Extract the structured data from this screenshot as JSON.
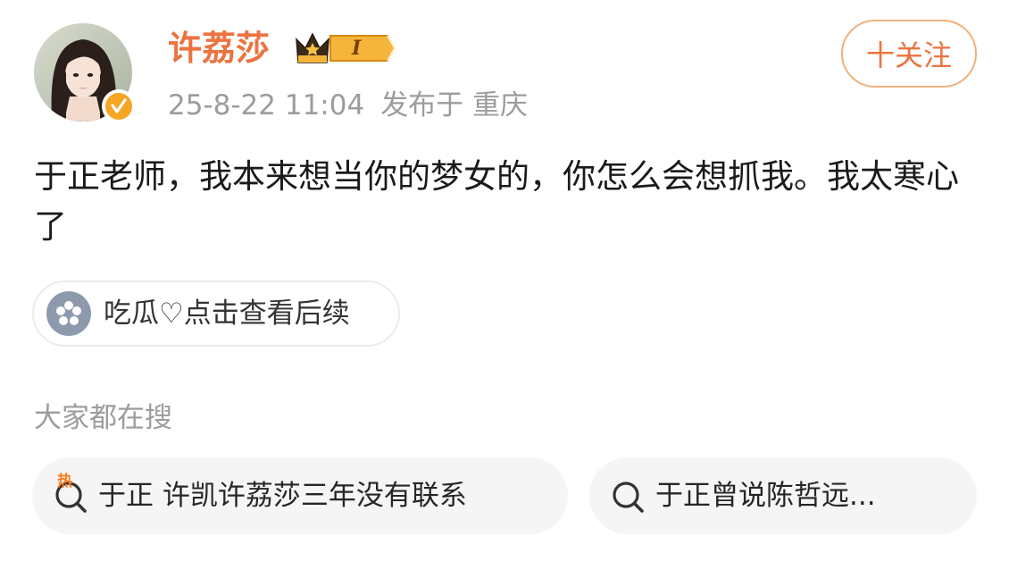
{
  "post": {
    "author": {
      "name": "许荔莎",
      "vip_level": "I"
    },
    "meta": {
      "time": "25-8-22 11:04",
      "location": "发布于 重庆"
    },
    "follow_label": "十关注",
    "text": "于正老师，我本来想当你的梦女的，你怎么会想抓我。我太寒心了",
    "topic": {
      "label": "吃瓜♡点击查看后续",
      "icon": "flower-icon"
    }
  },
  "search_section": {
    "heading": "大家都在搜",
    "hot_mark": "热",
    "items": [
      {
        "text": "于正 许凯许荔莎三年没有联系",
        "icon": "hot-search-icon"
      },
      {
        "text": "于正曾说陈哲远...",
        "icon": "search-icon"
      }
    ]
  },
  "colors": {
    "brand_orange": "#eb7340",
    "follow_border": "#f0b07a",
    "meta_gray": "#9c9c9c",
    "chip_bg": "#f5f5f5",
    "vip_gold": "#f5b43a"
  }
}
